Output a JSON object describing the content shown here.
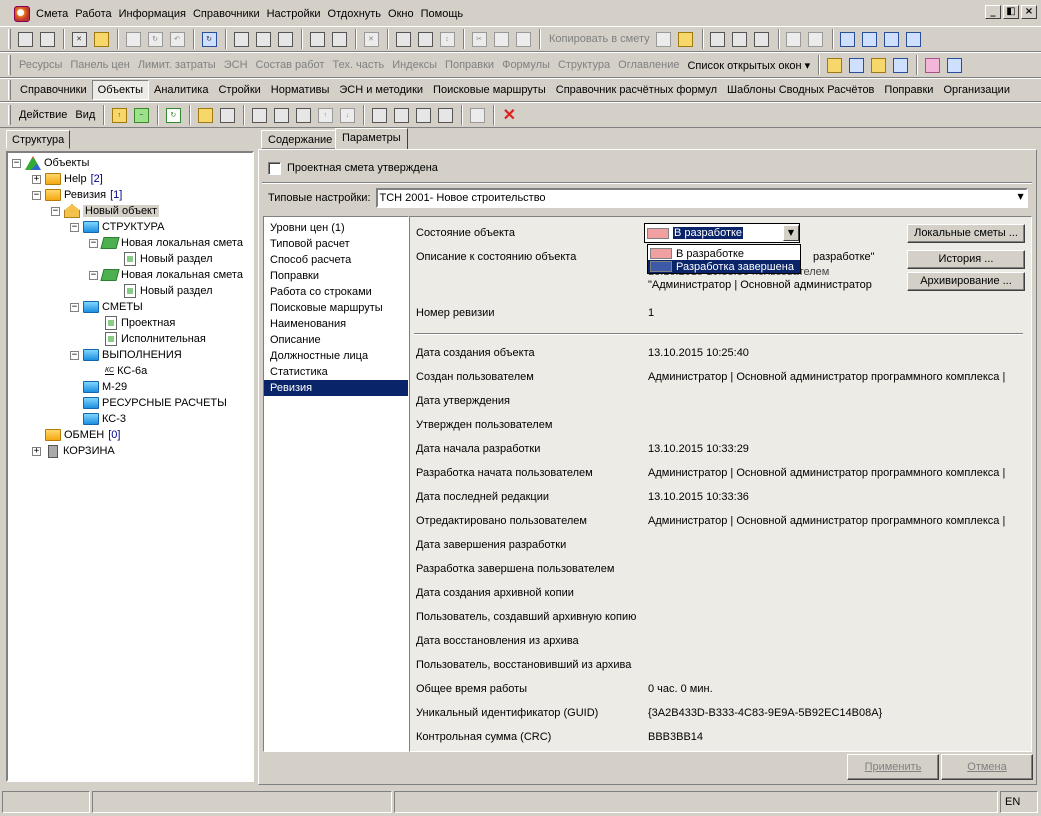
{
  "menu": [
    "Смета",
    "Работа",
    "Информация",
    "Справочники",
    "Настройки",
    "Отдохнуть",
    "Окно",
    "Помощь"
  ],
  "window_buttons": [
    "_",
    "◧",
    "×"
  ],
  "toolbar1": {
    "copy_to_estimate_label": "Копировать в смету"
  },
  "toolbar2": {
    "items": [
      "Ресурсы",
      "Панель цен",
      "Лимит. затраты",
      "ЭСН",
      "Состав работ",
      "Тех. часть",
      "Индексы",
      "Поправки",
      "Формулы",
      "Структура",
      "Оглавление"
    ],
    "open_windows_label": "Список открытых окон ▾"
  },
  "tabs_row": {
    "items": [
      "Справочники",
      "Объекты",
      "Аналитика",
      "Стройки",
      "Нормативы",
      "ЭСН и методики",
      "Поисковые маршруты",
      "Справочник расчётных формул",
      "Шаблоны Сводных Расчётов",
      "Поправки",
      "Организации"
    ],
    "active": "Объекты"
  },
  "action_bar": {
    "action_label": "Действие",
    "view_label": "Вид"
  },
  "left_tab": "Структура",
  "tree": {
    "root": "Объекты",
    "help": {
      "label": "Help",
      "count": "[2]"
    },
    "revision": {
      "label": "Ревизия",
      "count": "[1]"
    },
    "new_object": "Новый объект",
    "structure": "СТРУКТУРА",
    "local_estimate_1": "Новая локальная смета",
    "section_1": "Новый раздел",
    "local_estimate_2": "Новая локальная смета",
    "section_2": "Новый раздел",
    "estimates": "СМЕТЫ",
    "design": "Проектная",
    "executive": "Исполнительная",
    "executions": "ВЫПОЛНЕНИЯ",
    "ks6a": "КС-6а",
    "m29": "М-29",
    "resource_calcs": "РЕСУРСНЫЕ РАСЧЕТЫ",
    "ks3": "КС-3",
    "exchange": {
      "label": "ОБМЕН",
      "count": "[0]"
    },
    "trash": "КОРЗИНА",
    "icon_text_ks": "КС"
  },
  "right_tabs": {
    "content": "Содержание",
    "params": "Параметры",
    "active": "Параметры"
  },
  "approved_checkbox": {
    "label": "Проектная смета утверждена",
    "checked": false
  },
  "typical_settings": {
    "label": "Типовые настройки:",
    "value": "ТСН 2001- Новое строительство"
  },
  "sections": {
    "items": [
      "Уровни цен (1)",
      "Типовой расчет",
      "Способ расчета",
      "Поправки",
      "Работа со строками",
      "Поисковые маршруты",
      "Наименования",
      "Описание",
      "Должностные лица",
      "Статистика",
      "Ревизия"
    ],
    "selected": "Ревизия"
  },
  "state": {
    "label": "Состояние объекта",
    "value": "В разработке",
    "swatch_color": "#f0a0a0",
    "options": [
      {
        "label": "В разработке",
        "color": "#f0a0a0"
      },
      {
        "label": "Разработка завершена",
        "color": "#3c5aa8"
      }
    ]
  },
  "state_description": {
    "label": "Описание к состоянию объекта",
    "line1_tail": "разработке\"",
    "line2": "13.10.2015 10:33:36 пользователем",
    "line3": "\"Администратор  |  Основной администратор"
  },
  "side_buttons": {
    "local_estimates": "Локальные сметы ...",
    "history": "История ...",
    "archive": "Архивирование ..."
  },
  "revision_number": {
    "label": "Номер ревизии",
    "value": "1"
  },
  "fields": [
    {
      "label": "Дата создания объекта",
      "value": "13.10.2015 10:25:40"
    },
    {
      "label": "Создан пользователем",
      "value": "Администратор  |  Основной администратор программного комплекса  |"
    },
    {
      "label": "Дата утверждения",
      "value": ""
    },
    {
      "label": "Утвержден пользователем",
      "value": ""
    },
    {
      "label": "Дата начала разработки",
      "value": "13.10.2015 10:33:29"
    },
    {
      "label": "Разработка начата пользователем",
      "value": "Администратор  |  Основной администратор программного комплекса  |"
    },
    {
      "label": "Дата последней редакции",
      "value": "13.10.2015 10:33:36"
    },
    {
      "label": "Отредактировано пользователем",
      "value": "Администратор  |  Основной администратор программного комплекса  |"
    },
    {
      "label": "Дата завершения разработки",
      "value": ""
    },
    {
      "label": "Разработка завершена пользователем",
      "value": ""
    },
    {
      "label": "Дата создания архивной копии",
      "value": ""
    },
    {
      "label": "Пользователь, создавший архивную копию",
      "value": ""
    },
    {
      "label": "Дата восстановления из архива",
      "value": ""
    },
    {
      "label": "Пользователь, восстановивший из архива",
      "value": ""
    },
    {
      "label": "Общее время работы",
      "value": "0 час. 0 мин."
    },
    {
      "label": "Уникальный идентификатор (GUID)",
      "value": "{3A2B433D-B333-4C83-9E9A-5B92EC14B08A}"
    },
    {
      "label": "Контрольная сумма (CRC)",
      "value": "BBB3BB14"
    }
  ],
  "bottom_buttons": {
    "apply": "Применить",
    "cancel": "Отмена"
  },
  "status_bar": {
    "lang": "EN"
  }
}
